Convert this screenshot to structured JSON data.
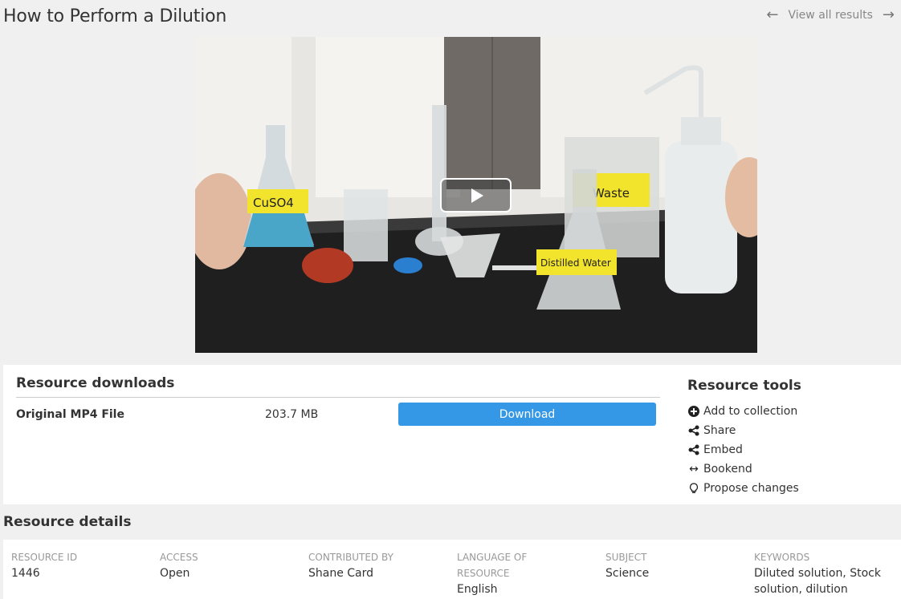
{
  "page": {
    "title": "How to Perform a Dilution",
    "view_all_label": "View all results",
    "prev_icon": "arrow-left-icon",
    "next_icon": "arrow-right-icon"
  },
  "video": {
    "play_icon": "play-icon",
    "labels": {
      "flask": "CuSO4",
      "beaker": "Waste",
      "distilled": "Distilled Water"
    }
  },
  "downloads": {
    "heading": "Resource downloads",
    "files": [
      {
        "name": "Original MP4 File",
        "size": "203.7 MB",
        "button": "Download"
      }
    ]
  },
  "tools": {
    "heading": "Resource tools",
    "items": [
      {
        "label": "Add to collection",
        "icon": "plus-circle-icon"
      },
      {
        "label": "Share",
        "icon": "share-icon"
      },
      {
        "label": "Embed",
        "icon": "share-icon"
      },
      {
        "label": "Bookend",
        "icon": "arrows-horizontal-icon"
      },
      {
        "label": "Propose changes",
        "icon": "lightbulb-icon"
      }
    ]
  },
  "details": {
    "heading": "Resource details",
    "fields": [
      {
        "label": "RESOURCE ID",
        "value": "1446"
      },
      {
        "label": "ACCESS",
        "value": "Open"
      },
      {
        "label": "CONTRIBUTED BY",
        "value": "Shane Card"
      },
      {
        "label": "LANGUAGE OF RESOURCE",
        "value": "English"
      },
      {
        "label": "SUBJECT",
        "value": "Science"
      },
      {
        "label": "KEYWORDS",
        "value": "Diluted solution, Stock solution, dilution"
      }
    ]
  },
  "colors": {
    "accent": "#3598e6",
    "background": "#f0f0f0"
  }
}
